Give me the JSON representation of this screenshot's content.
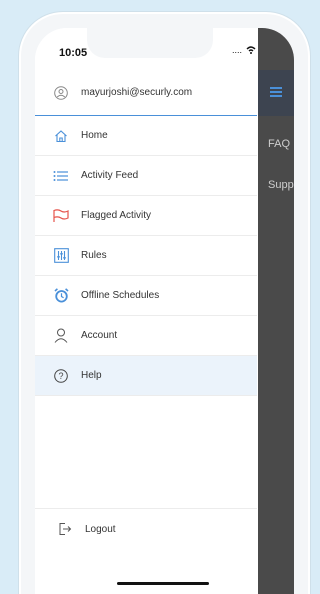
{
  "status": {
    "time": "10:05",
    "signal": "....",
    "wifi": "wifi-icon",
    "battery": "battery-icon"
  },
  "drawer": {
    "account_email": "mayurjoshi@securly.com",
    "items": [
      {
        "label": "Home",
        "icon": "home-icon"
      },
      {
        "label": "Activity Feed",
        "icon": "list-icon"
      },
      {
        "label": "Flagged Activity",
        "icon": "flag-icon"
      },
      {
        "label": "Rules",
        "icon": "sliders-icon"
      },
      {
        "label": "Offline Schedules",
        "icon": "alarm-clock-icon"
      },
      {
        "label": "Account",
        "icon": "user-icon"
      },
      {
        "label": "Help",
        "icon": "help-icon"
      }
    ],
    "logout_label": "Logout"
  },
  "background_screen": {
    "items": [
      "FAQ",
      "Supp"
    ]
  },
  "colors": {
    "accent": "#4a90d9",
    "flag": "#e5534b",
    "active_bg": "#ebf3fb"
  }
}
